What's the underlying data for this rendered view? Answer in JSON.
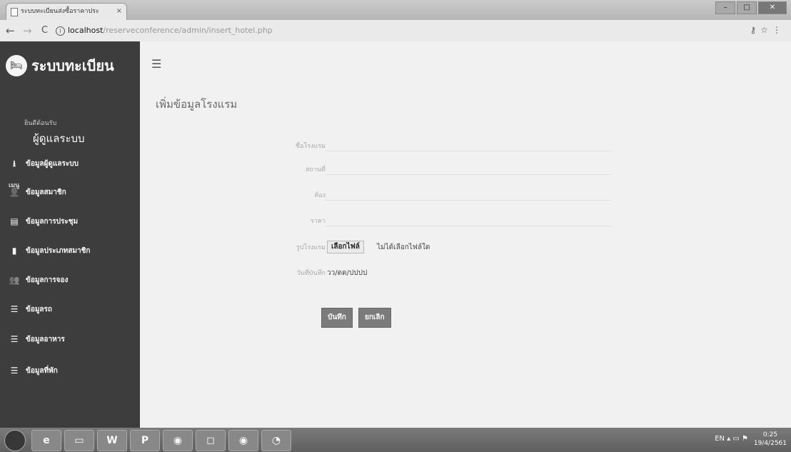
{
  "browser": {
    "tab_title": "ระบบทะเบียนส่งซื้อราคาประ",
    "tab_close": "×",
    "url_host": "localhost",
    "url_path": "/reserveconference/admin/insert_hotel.php",
    "back": "←",
    "forward": "→",
    "reload": "C",
    "info": "i"
  },
  "sidebar": {
    "brand_icon": "bed-icon",
    "brand_title": "ระบบทะเบียน",
    "welcome": "ยินดีต้อนรับ",
    "username": "ผู้ดูแลระบบ",
    "menu_heading": "เมนู",
    "items": [
      {
        "label": "ข้อมูลผู้ดูแลระบบ",
        "icon": "download-user-icon",
        "glyph": "⭳"
      },
      {
        "label": "ข้อมูลสมาชิก",
        "icon": "user-icon",
        "glyph": "👤"
      },
      {
        "label": "ข้อมูลการประชุม",
        "icon": "id-card-icon",
        "glyph": "▤"
      },
      {
        "label": "ข้อมูลประเภทสมาชิก",
        "icon": "file-icon",
        "glyph": "▮"
      },
      {
        "label": "ข้อมูลการจอง",
        "icon": "users-icon",
        "glyph": "👥"
      },
      {
        "label": "ข้อมูลรถ",
        "icon": "list-icon",
        "glyph": "☰"
      },
      {
        "label": "ข้อมูลอาหาร",
        "icon": "list-icon",
        "glyph": "☰"
      },
      {
        "label": "ข้อมูลที่พัก",
        "icon": "list-icon",
        "glyph": "☰"
      }
    ]
  },
  "main": {
    "page_title": "เพิ่มข้อมูลโรงแรม",
    "form": {
      "hotel_name_label": "ชื่อโรงแรม",
      "location_label": "สถานที่",
      "phone_label": "ห้อง",
      "price_label": "ราคา",
      "image_label": "รูปโรงแรม",
      "file_button": "เลือกไฟล์",
      "file_status": "ไม่ได้เลือกไฟล์ใด",
      "date_label": "วันที่บันทึก",
      "date_value": "วว/ดด/ปปปป"
    },
    "save_button": "บันทึก",
    "cancel_button": "ยกเลิก"
  },
  "taskbar": {
    "apps": [
      "e",
      "▭",
      "W",
      "P",
      "◉",
      "◻",
      "◉",
      "◔"
    ],
    "lang": "EN",
    "time": "0:25",
    "date": "19/4/2561"
  }
}
